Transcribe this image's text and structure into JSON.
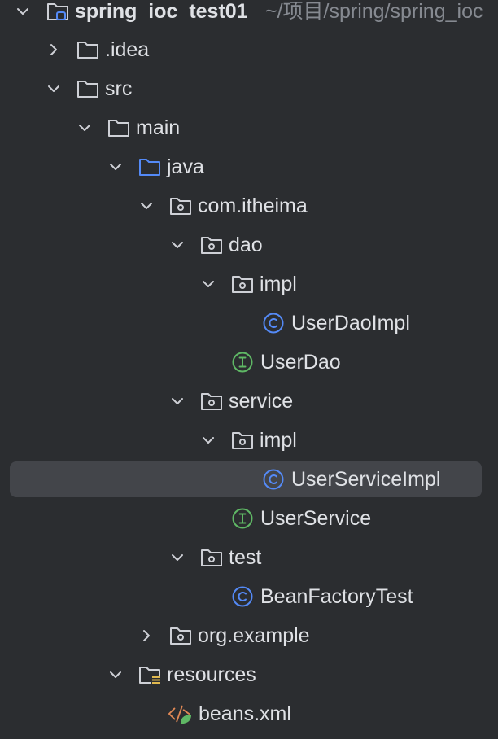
{
  "tree": {
    "root": {
      "label": "spring_ioc_test01",
      "path": "~/项目/spring/spring_ioc"
    },
    "nodes": [
      {
        "label": ".idea",
        "icon": "folder-icon",
        "expanded": false
      },
      {
        "label": "src",
        "icon": "folder-icon",
        "expanded": true
      },
      {
        "label": "main",
        "icon": "folder-icon",
        "expanded": true
      },
      {
        "label": "java",
        "icon": "source-folder-icon",
        "expanded": true
      },
      {
        "label": "com.itheima",
        "icon": "package-icon",
        "expanded": true
      },
      {
        "label": "dao",
        "icon": "package-icon",
        "expanded": true
      },
      {
        "label": "impl",
        "icon": "package-icon",
        "expanded": true
      },
      {
        "label": "UserDaoImpl",
        "icon": "class-icon"
      },
      {
        "label": "UserDao",
        "icon": "interface-icon"
      },
      {
        "label": "service",
        "icon": "package-icon",
        "expanded": true
      },
      {
        "label": "impl",
        "icon": "package-icon",
        "expanded": true
      },
      {
        "label": "UserServiceImpl",
        "icon": "class-icon",
        "selected": true
      },
      {
        "label": "UserService",
        "icon": "interface-icon"
      },
      {
        "label": "test",
        "icon": "package-icon",
        "expanded": true
      },
      {
        "label": "BeanFactoryTest",
        "icon": "class-icon"
      },
      {
        "label": "org.example",
        "icon": "package-icon",
        "expanded": false
      },
      {
        "label": "resources",
        "icon": "resources-folder-icon",
        "expanded": true
      },
      {
        "label": "beans.xml",
        "icon": "xml-file-icon"
      }
    ]
  },
  "colors": {
    "background": "#2b2d30",
    "text": "#dfe1e5",
    "muted": "#868a91",
    "selection": "#43454a",
    "folder": "#ced0d6",
    "source_folder": "#548af7",
    "class": "#548af7",
    "interface": "#5fb865",
    "xml_orange": "#e08855",
    "xml_green": "#5fb865"
  }
}
